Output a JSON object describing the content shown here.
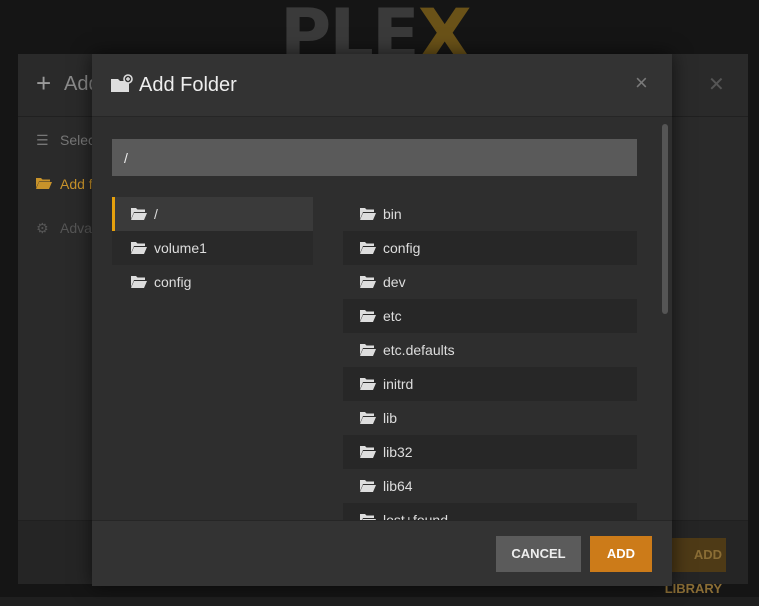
{
  "background": {
    "logo": {
      "text_main": "PLE",
      "text_accent": "X"
    },
    "underlying_dialog": {
      "title": "Add Library",
      "nav": [
        {
          "label": "Select type",
          "icon": "list-icon"
        },
        {
          "label": "Add folders",
          "icon": "folder-open-icon"
        },
        {
          "label": "Advanced",
          "icon": "gear-icon"
        }
      ],
      "footer_button": "ADD LIBRARY"
    }
  },
  "dialog": {
    "title": "Add Folder",
    "title_icon": "folder-add-icon",
    "close_glyph": "×",
    "path_value": "/",
    "left_folders": [
      {
        "label": "/",
        "selected": true
      },
      {
        "label": "volume1",
        "selected": false
      },
      {
        "label": "config",
        "selected": false
      }
    ],
    "right_folders": [
      {
        "label": "bin"
      },
      {
        "label": "config"
      },
      {
        "label": "dev"
      },
      {
        "label": "etc"
      },
      {
        "label": "etc.defaults"
      },
      {
        "label": "initrd"
      },
      {
        "label": "lib"
      },
      {
        "label": "lib32"
      },
      {
        "label": "lib64"
      },
      {
        "label": "lost+found"
      }
    ],
    "buttons": {
      "cancel": "CANCEL",
      "add": "ADD"
    }
  },
  "colors": {
    "accent": "#e5a00d",
    "add_button": "#cc7b19",
    "cancel_button": "#5b5b5b"
  }
}
